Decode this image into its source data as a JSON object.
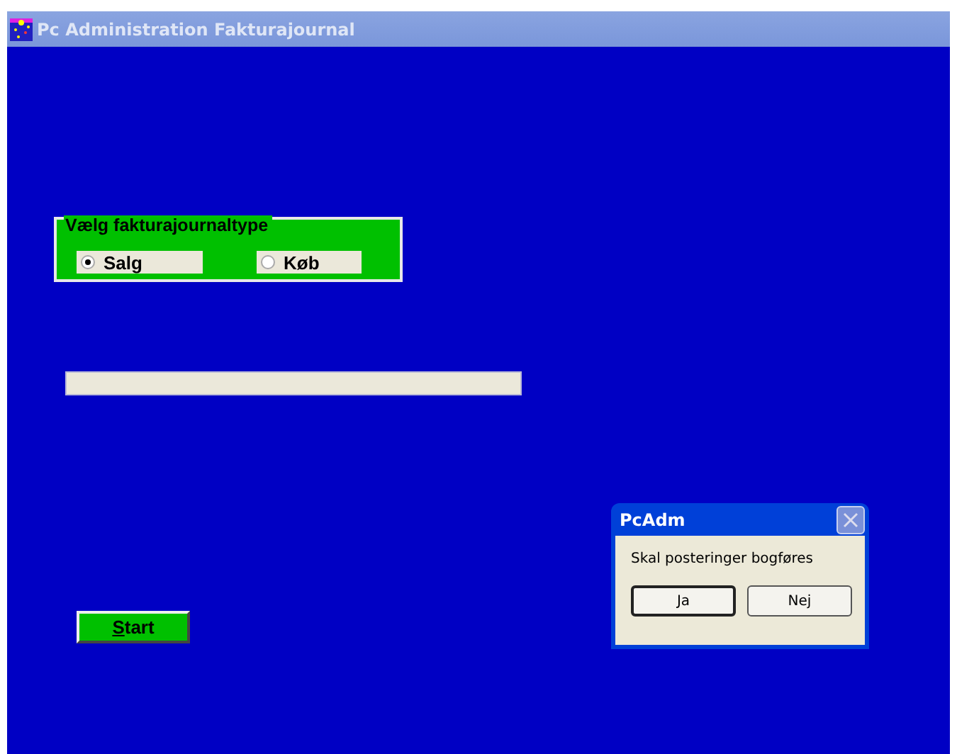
{
  "window": {
    "title": "Pc Administration Fakturajournal"
  },
  "journal_type_group": {
    "legend": "Vælg fakturajournaltype",
    "options": [
      {
        "label": "Salg",
        "selected": true
      },
      {
        "label": "Køb",
        "selected": false
      }
    ]
  },
  "progress": {
    "level": 0
  },
  "start_button": {
    "label": "Start",
    "access_key_underlined": true
  },
  "dialog": {
    "title": "PcAdm",
    "message": "Skal posteringer bogføres",
    "buttons": [
      {
        "label": "Ja",
        "default": true
      },
      {
        "label": "Nej",
        "default": false
      }
    ]
  }
}
